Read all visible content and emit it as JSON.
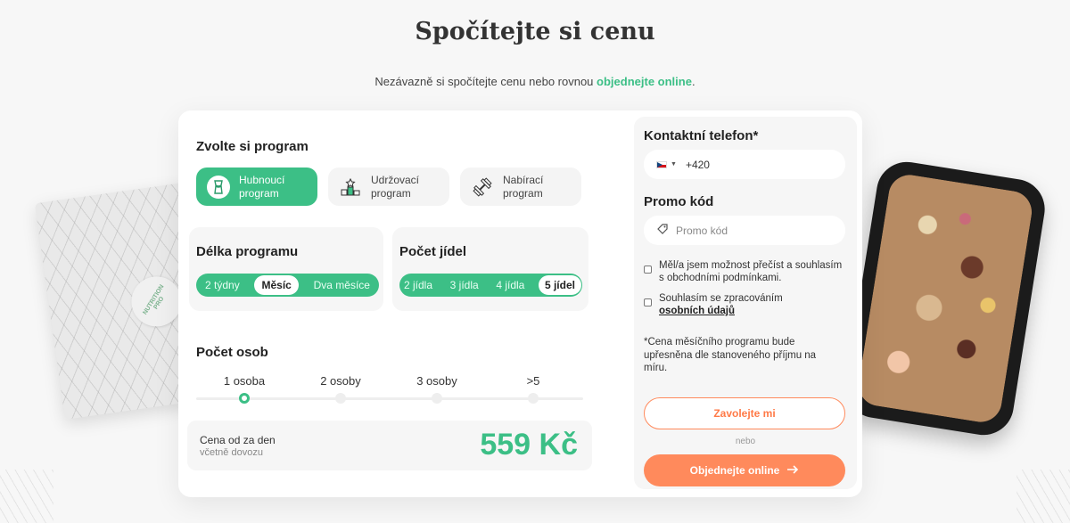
{
  "header": {
    "title": "Spočítejte si cenu",
    "subtitle_prefix": "Nezávazně si spočítejte cenu nebo rovnou",
    "subtitle_link": "objednejte online",
    "subtitle_suffix": "."
  },
  "bag": {
    "logo_text": "NUTRITION PRO"
  },
  "program": {
    "title": "Zvolte si program",
    "options": [
      {
        "label": "Hubnoucí program",
        "icon": "slim-body-icon",
        "selected": true
      },
      {
        "label": "Udržovací program",
        "icon": "podium-icon",
        "selected": false
      },
      {
        "label": "Nabírací program",
        "icon": "dumbbell-icon",
        "selected": false
      }
    ]
  },
  "length": {
    "title": "Délka programu",
    "options": [
      "2 týdny",
      "Měsíc",
      "Dva měsíce"
    ],
    "selected": "Měsíc"
  },
  "meals": {
    "title": "Počet jídel",
    "options": [
      "2 jídla",
      "3 jídla",
      "4 jídla",
      "5 jídel"
    ],
    "selected": "5 jídel"
  },
  "persons": {
    "title": "Počet osob",
    "options": [
      "1 osoba",
      "2 osoby",
      "3 osoby",
      ">5"
    ],
    "selected": "1 osoba"
  },
  "price": {
    "label": "Cena od za den",
    "sub": "včetně dovozu",
    "value": "559 Kč"
  },
  "contact": {
    "phone_title": "Kontaktní telefon*",
    "phone_prefix": "+420",
    "flag": "czech-flag-icon",
    "promo_title": "Promo kód",
    "promo_placeholder": "Promo kód",
    "consent_terms": "Měl/a jsem možnost přečíst a souhlasím s obchodními podmínkami.",
    "consent_data_prefix": "Souhlasím se zpracováním",
    "consent_data_link": "osobních údajů",
    "note": "*Cena měsíčního programu bude upřesněna dle stanoveného příjmu na míru.",
    "call_label": "Zavolejte mi",
    "or_label": "nebo",
    "order_label": "Objednejte online",
    "order_icon": "arrow-right-icon"
  },
  "colors": {
    "accent": "#3cbf86",
    "cta": "#ff8a5c"
  }
}
